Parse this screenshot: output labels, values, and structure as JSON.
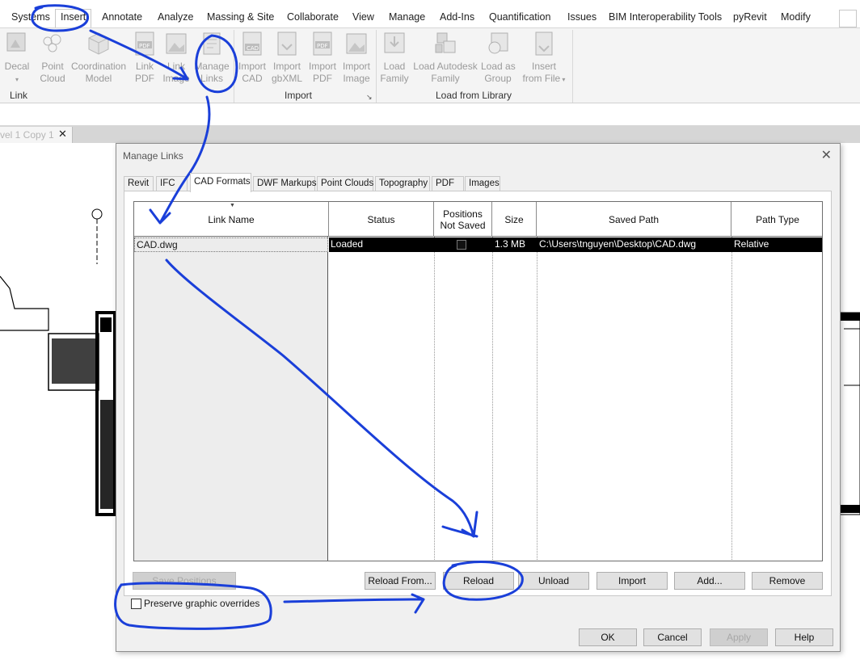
{
  "ribbon": {
    "tabs": [
      "Systems",
      "Insert",
      "Annotate",
      "Analyze",
      "Massing & Site",
      "Collaborate",
      "View",
      "Manage",
      "Add-Ins",
      "Quantification",
      "Issues",
      "BIM Interoperability Tools",
      "pyRevit",
      "Modify"
    ],
    "active_tab": "Insert",
    "groups": {
      "link": {
        "label": "Link",
        "tools": [
          {
            "line1": "Decal",
            "line2": "▾",
            "icon": "decal-icon"
          },
          {
            "line1": "Point",
            "line2": "Cloud",
            "icon": "point-cloud-icon"
          },
          {
            "line1": "Coordination",
            "line2": "Model",
            "icon": "coordination-model-icon"
          },
          {
            "line1": "Link",
            "line2": "PDF",
            "icon": "link-pdf-icon"
          },
          {
            "line1": "Link",
            "line2": "Image",
            "icon": "link-image-icon"
          },
          {
            "line1": "Manage",
            "line2": "Links",
            "icon": "manage-links-icon"
          }
        ]
      },
      "import": {
        "label": "Import",
        "tools": [
          {
            "line1": "Import",
            "line2": "CAD",
            "icon": "import-cad-icon"
          },
          {
            "line1": "Import",
            "line2": "gbXML",
            "icon": "import-gbxml-icon"
          },
          {
            "line1": "Import",
            "line2": "PDF",
            "icon": "import-pdf-icon"
          },
          {
            "line1": "Import",
            "line2": "Image",
            "icon": "import-image-icon"
          }
        ]
      },
      "load": {
        "label": "Load from Library",
        "tools": [
          {
            "line1": "Load",
            "line2": "Family",
            "icon": "load-family-icon"
          },
          {
            "line1": "Load Autodesk",
            "line2": "Family",
            "icon": "load-autodesk-family-icon"
          },
          {
            "line1": "Load as",
            "line2": "Group",
            "icon": "load-as-group-icon"
          },
          {
            "line1": "Insert",
            "line2": "from File",
            "icon": "insert-from-file-icon"
          }
        ]
      }
    }
  },
  "view_tab": {
    "label": "vel 1 Copy 1",
    "close": "✕"
  },
  "dialog": {
    "title": "Manage Links",
    "close": "✕",
    "tabs": [
      "Revit",
      "IFC",
      "CAD Formats",
      "DWF Markups",
      "Point Clouds",
      "Topography",
      "PDF",
      "Images"
    ],
    "active_tab": "CAD Formats",
    "columns": [
      "Link Name",
      "Status",
      "Positions Not Saved",
      "Size",
      "Saved Path",
      "Path Type"
    ],
    "rows": [
      {
        "link_name": "CAD.dwg",
        "status": "Loaded",
        "positions_not_saved": false,
        "size": "1.3 MB",
        "saved_path": "C:\\Users\\tnguyen\\Desktop\\CAD.dwg",
        "path_type": "Relative"
      }
    ],
    "buttons": {
      "save_positions": "Save Positions",
      "reload_from": "Reload From...",
      "reload": "Reload",
      "unload": "Unload",
      "import": "Import",
      "add": "Add...",
      "remove": "Remove",
      "ok": "OK",
      "cancel": "Cancel",
      "apply": "Apply",
      "help": "Help"
    },
    "preserve_overrides_label": "Preserve graphic overrides",
    "preserve_overrides_checked": false
  },
  "colors": {
    "annotation_blue": "#1a3fd9",
    "selection_row": "#000000",
    "ribbon_bg": "#f4f4f4"
  }
}
